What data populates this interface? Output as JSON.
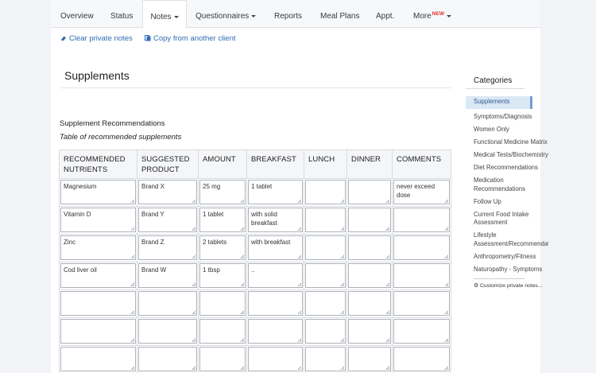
{
  "tabs": [
    {
      "label": "Overview",
      "dropdown": false
    },
    {
      "label": "Status",
      "dropdown": false
    },
    {
      "label": "Notes",
      "dropdown": true,
      "active": true
    },
    {
      "label": "Questionnaires",
      "dropdown": true
    },
    {
      "label": "Reports",
      "dropdown": false
    },
    {
      "label": "Meal Plans",
      "dropdown": false
    },
    {
      "label": "Appt.",
      "dropdown": false
    },
    {
      "label": "More",
      "dropdown": true,
      "badge": "NEW"
    }
  ],
  "actions": {
    "clear_label": "Clear private notes",
    "copy_label": "Copy from another client"
  },
  "page_title": "Supplements",
  "section": {
    "heading": "Supplement Recommendations",
    "caption": "Table of recommended supplements"
  },
  "table": {
    "headers": [
      "RECOMMENDED NUTRIENTS",
      "SUGGESTED PRODUCT",
      "AMOUNT",
      "BREAKFAST",
      "LUNCH",
      "DINNER",
      "COMMENTS"
    ],
    "rows": [
      [
        "Magnesium",
        "Brand X",
        "25 mg",
        "1 tablet",
        "",
        "",
        "never exceed dose"
      ],
      [
        "Vitamin D",
        "Brand Y",
        "1 tablet",
        "with solid breakfast",
        "",
        "",
        ""
      ],
      [
        "Zinc",
        "Brand Z",
        "2 tablets",
        "with breakfast",
        "",
        "",
        ""
      ],
      [
        "Cod liver oil",
        "Brand W",
        "1 tbsp",
        "..",
        "",
        "",
        ""
      ],
      [
        "",
        "",
        "",
        "",
        "",
        "",
        ""
      ],
      [
        "",
        "",
        "",
        "",
        "",
        "",
        ""
      ],
      [
        "",
        "",
        "",
        "",
        "",
        "",
        ""
      ]
    ]
  },
  "sidebar": {
    "title": "Categories",
    "items": [
      "Supplements",
      "Symptoms/Diagnosis",
      "Women Only",
      "Functional Medicine Matrix",
      "Medical Tests/Biochemistry",
      "Diet Recommendations",
      "Medication Recommendations",
      "Follow Up",
      "Current Food Intake Assessment",
      "Lifestyle Assessment/Recommendations",
      "Anthropometry/Fitness",
      "Naturopathy - Symptoms"
    ],
    "selected_index": 0,
    "customize_label": "Customize private notes..."
  },
  "colors": {
    "accent": "#2f6cb5",
    "new_badge": "#e0312b",
    "selected_bg": "#dbe8f6"
  }
}
